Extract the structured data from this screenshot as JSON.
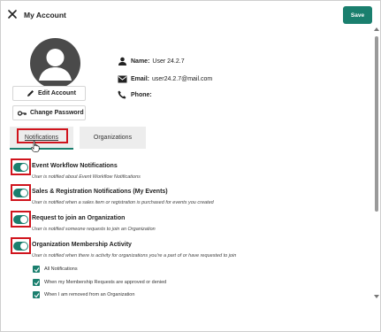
{
  "header": {
    "title": "My Account",
    "save_label": "Save",
    "accent": "#1a7f6e"
  },
  "profile": {
    "edit_label": "Edit Account",
    "change_password_label": "Change Password",
    "name_label": "Name:",
    "name_value": "User 24.2.7",
    "email_label": "Email:",
    "email_value": "user24.2.7@mail.com",
    "phone_label": "Phone:",
    "phone_value": ""
  },
  "tabs": [
    {
      "label": "Notifications",
      "active": true
    },
    {
      "label": "Organizations",
      "active": false
    }
  ],
  "notifications": [
    {
      "title": "Event Workflow Notifications",
      "description": "User is notified about Event Workflow Notifications",
      "enabled": true
    },
    {
      "title": "Sales & Registration Notifications (My Events)",
      "description": "User is notified when a sales item or registration is purchased for events you created",
      "enabled": true
    },
    {
      "title": "Request to join an Organization",
      "description": "User is notified someone requests to join an Organization",
      "enabled": true
    },
    {
      "title": "Organization Membership Activity",
      "description": "User is notified when there is activity for organizations you're a part of or have requested to join",
      "enabled": true
    }
  ],
  "membership_options": [
    {
      "label": "All Notifications",
      "checked": true
    },
    {
      "label": "When my Membership Requests are approved or denied",
      "checked": true
    },
    {
      "label": "When I am removed from an Organization",
      "checked": true
    }
  ],
  "highlight_color": "#d0141d"
}
